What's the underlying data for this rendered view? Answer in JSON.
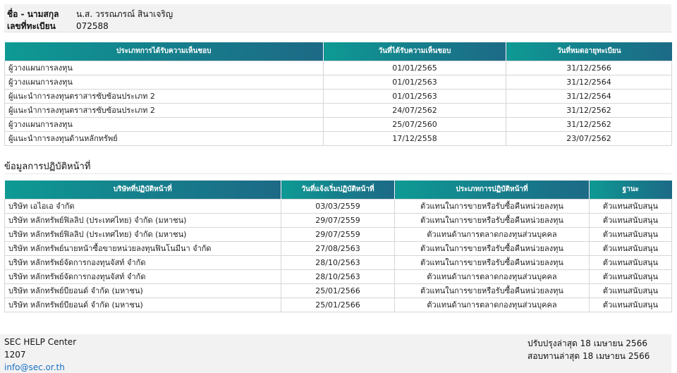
{
  "person": {
    "name_label": "ชื่อ - นามสกุล",
    "name_value": "น.ส. วรรณภรณ์ สินาเจริญ",
    "reg_label": "เลขที่ทะเบียน",
    "reg_value": "072588"
  },
  "approvals": {
    "headers": [
      "ประเภทการได้รับความเห็นชอบ",
      "วันที่ได้รับความเห็นชอบ",
      "วันที่หมดอายุทะเบียน"
    ],
    "rows": [
      [
        "ผู้วางแผนการลงทุน",
        "01/01/2565",
        "31/12/2566"
      ],
      [
        "ผู้วางแผนการลงทุน",
        "01/01/2563",
        "31/12/2564"
      ],
      [
        "ผู้แนะนำการลงทุนตราสารซับซ้อนประเภท 2",
        "01/01/2563",
        "31/12/2564"
      ],
      [
        "ผู้แนะนำการลงทุนตราสารซับซ้อนประเภท 2",
        "24/07/2562",
        "31/12/2562"
      ],
      [
        "ผู้วางแผนการลงทุน",
        "25/07/2560",
        "31/12/2562"
      ],
      [
        "ผู้แนะนำการลงทุนด้านหลักทรัพย์",
        "17/12/2558",
        "23/07/2562"
      ]
    ]
  },
  "work": {
    "section_title": "ข้อมูลการปฏิบัติหน้าที่",
    "headers": [
      "บริษัทที่ปฏิบัติหน้าที่",
      "วันที่แจ้งเริ่มปฏิบัติหน้าที่",
      "ประเภทการปฏิบัติหน้าที่",
      "ฐานะ"
    ],
    "rows": [
      [
        "บริษัท เอไอเอ จำกัด",
        "03/03/2559",
        "ตัวแทนในการขายหรือรับซื้อคืนหน่วยลงทุน",
        "ตัวแทนสนับสนุน"
      ],
      [
        "บริษัท หลักทรัพย์ฟิลลิป (ประเทศไทย) จำกัด (มหาชน)",
        "29/07/2559",
        "ตัวแทนในการขายหรือรับซื้อคืนหน่วยลงทุน",
        "ตัวแทนสนับสนุน"
      ],
      [
        "บริษัท หลักทรัพย์ฟิลลิป (ประเทศไทย) จำกัด (มหาชน)",
        "29/07/2559",
        "ตัวแทนด้านการตลาดกองทุนส่วนบุคคล",
        "ตัวแทนสนับสนุน"
      ],
      [
        "บริษัท หลักทรัพย์นายหน้าซื้อขายหน่วยลงทุนฟินโนมีนา จำกัด",
        "27/08/2563",
        "ตัวแทนในการขายหรือรับซื้อคืนหน่วยลงทุน",
        "ตัวแทนสนับสนุน"
      ],
      [
        "บริษัท หลักทรัพย์จัดการกองทุนจัสท์ จำกัด",
        "28/10/2563",
        "ตัวแทนในการขายหรือรับซื้อคืนหน่วยลงทุน",
        "ตัวแทนสนับสนุน"
      ],
      [
        "บริษัท หลักทรัพย์จัดการกองทุนจัสท์ จำกัด",
        "28/10/2563",
        "ตัวแทนด้านการตลาดกองทุนส่วนบุคคล",
        "ตัวแทนสนับสนุน"
      ],
      [
        "บริษัท หลักทรัพย์บียอนด์ จำกัด (มหาชน)",
        "25/01/2566",
        "ตัวแทนในการขายหรือรับซื้อคืนหน่วยลงทุน",
        "ตัวแทนสนับสนุน"
      ],
      [
        "บริษัท หลักทรัพย์บียอนด์ จำกัด (มหาชน)",
        "25/01/2566",
        "ตัวแทนด้านการตลาดกองทุนส่วนบุคคล",
        "ตัวแทนสนับสนุน"
      ]
    ]
  },
  "footer": {
    "center_name": "SEC HELP Center",
    "phone": "1207",
    "email": "info@sec.or.th",
    "updated": "ปรับปรุงล่าสุด 18 เมษายน 2566",
    "reviewed": "สอบทานล่าสุด 18 เมษายน 2566"
  }
}
